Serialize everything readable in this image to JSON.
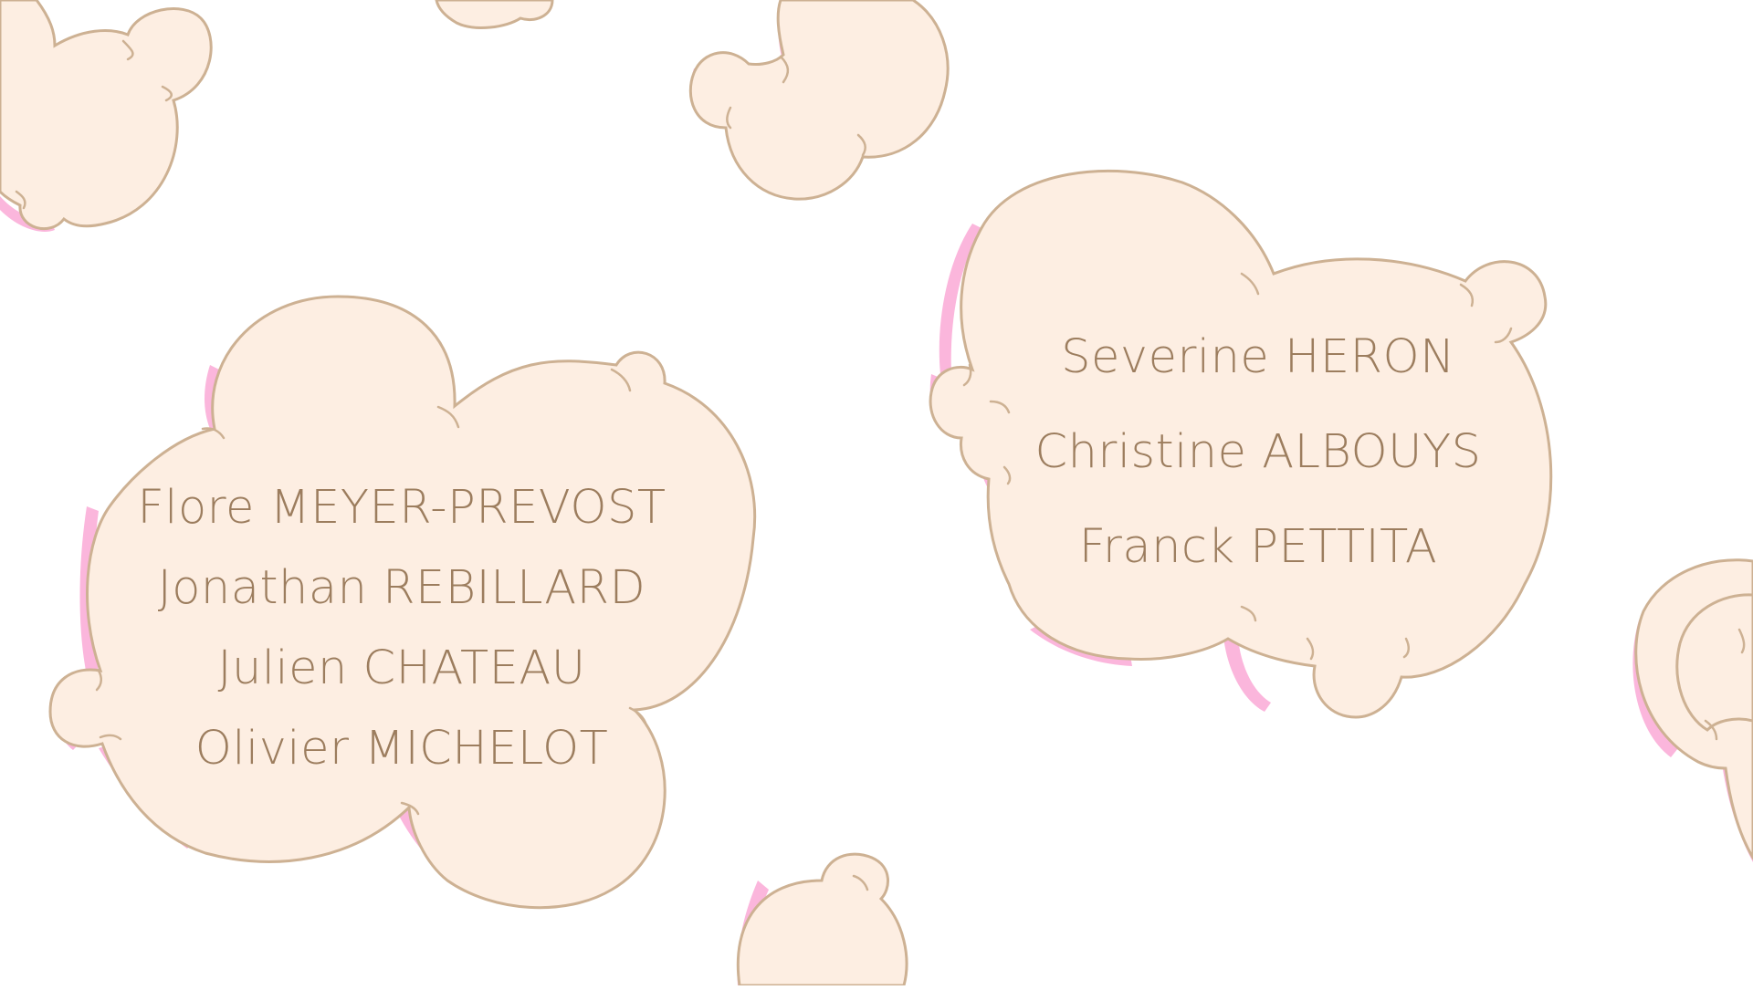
{
  "credits": {
    "cloud_left": {
      "names": [
        "Flore MEYER-PREVOST",
        "Jonathan REBILLARD",
        "Julien CHATEAU",
        "Olivier MICHELOT"
      ]
    },
    "cloud_right": {
      "names": [
        "Severine HERON",
        "Christine ALBOUYS",
        "Franck PETTITA"
      ]
    }
  },
  "palette": {
    "background": "#ffffff",
    "cloud_fill": "#fdeee2",
    "cloud_outline": "#cdb193",
    "cloud_shadow": "#fbb6dc",
    "text": "#9c7d5e"
  }
}
